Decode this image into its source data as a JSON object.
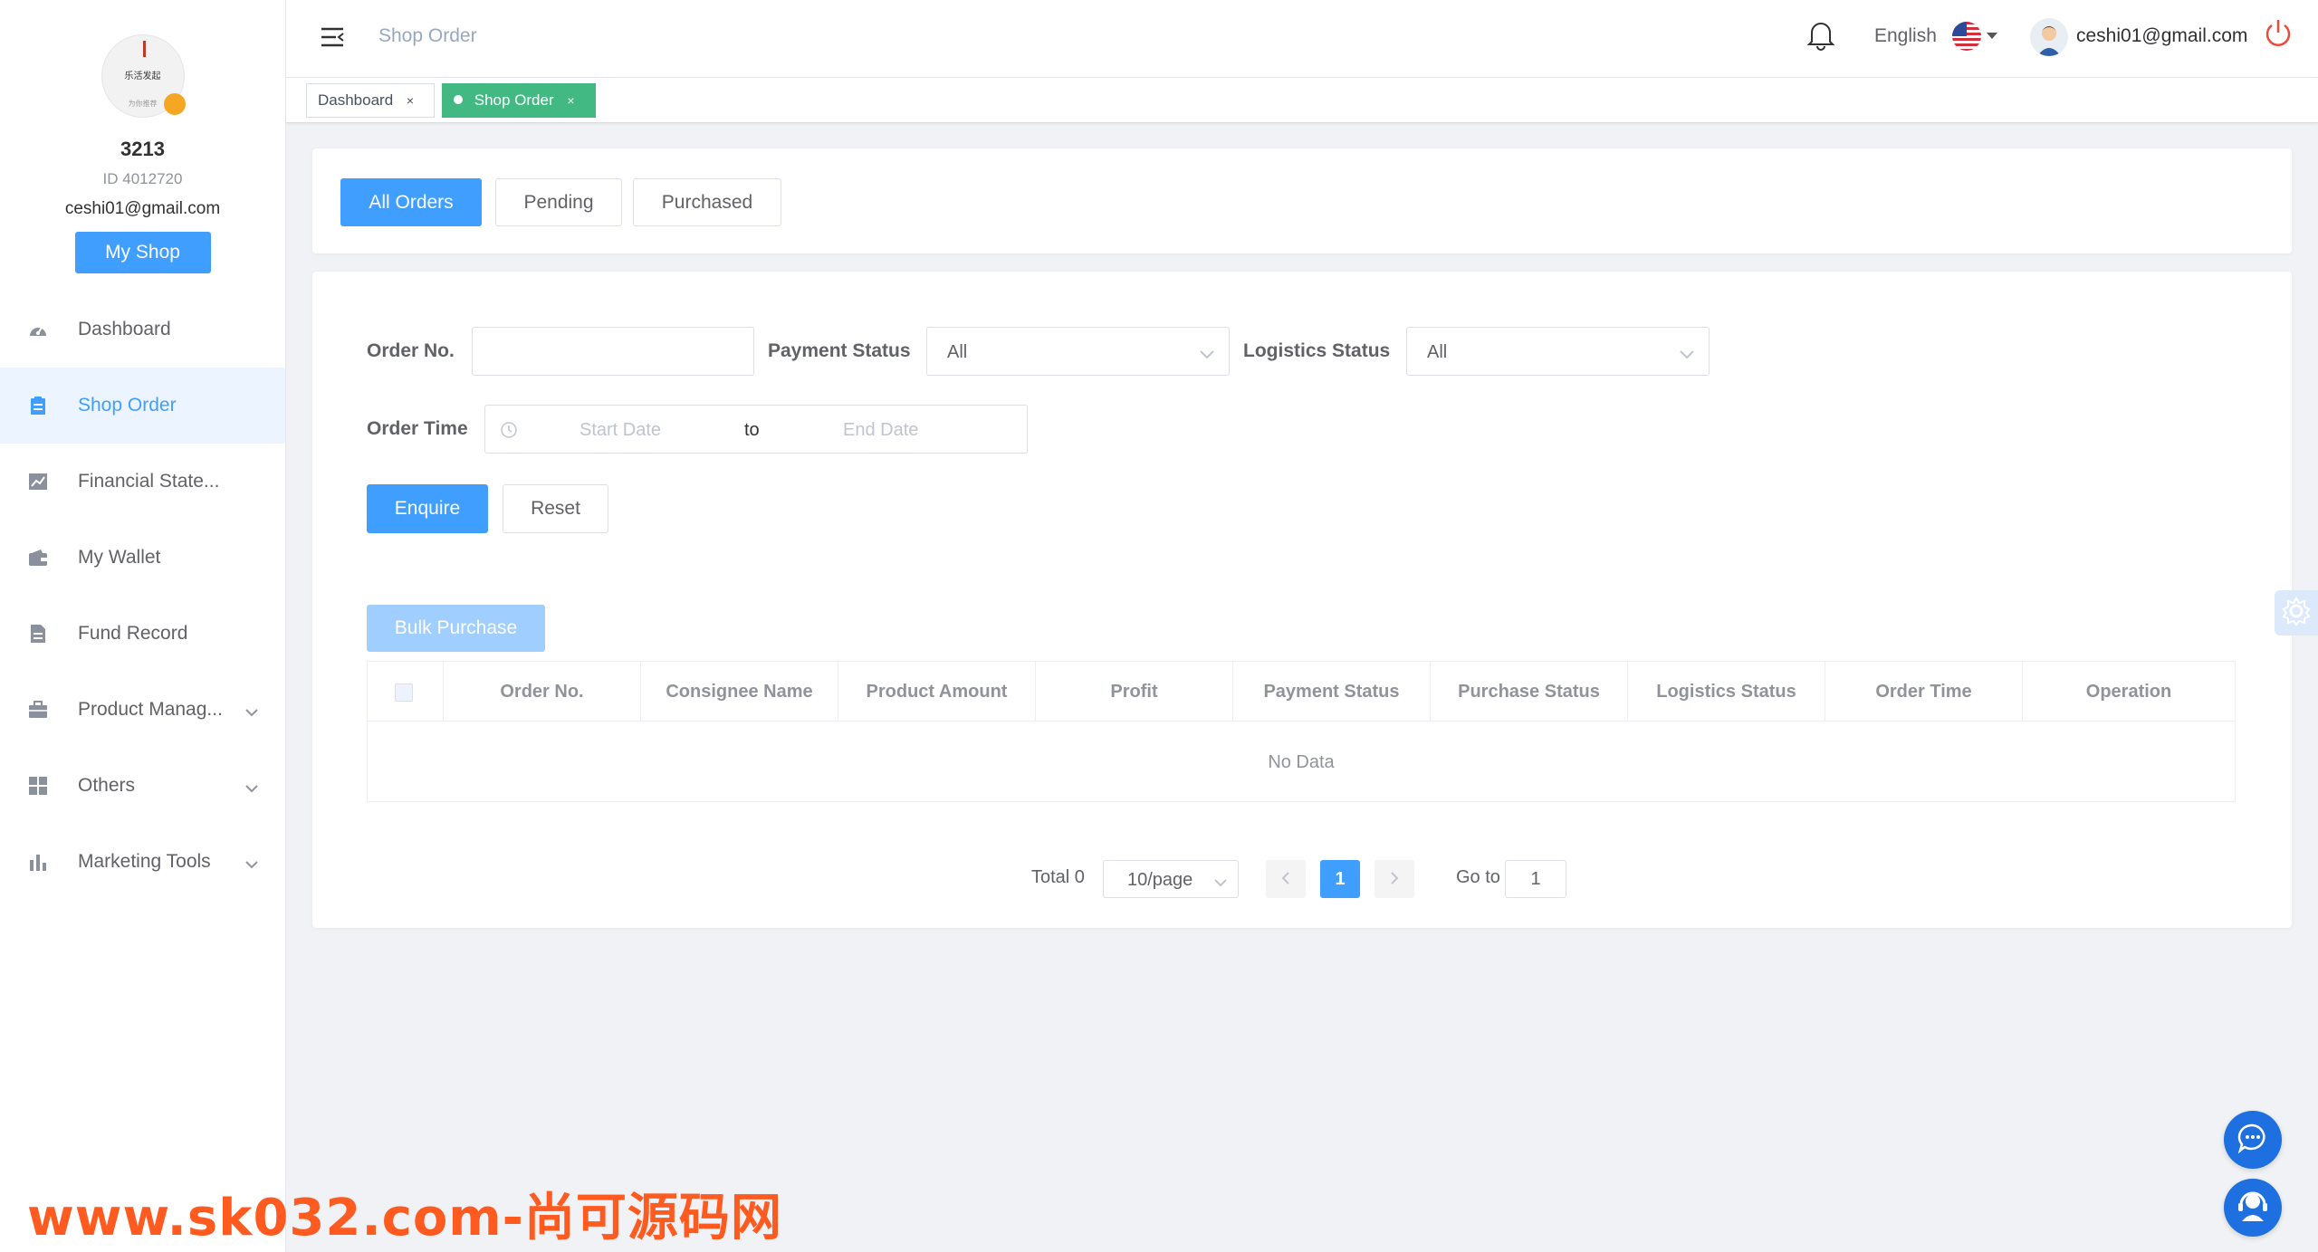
{
  "sidebar": {
    "avatar_text_top": "乐活发起",
    "avatar_text_bottom": "为你推荐",
    "username": "3213",
    "user_id": "ID 4012720",
    "email": "ceshi01@gmail.com",
    "my_shop_label": "My Shop",
    "items": [
      {
        "label": "Dashboard",
        "icon": "gauge-icon"
      },
      {
        "label": "Shop Order",
        "icon": "clipboard-icon"
      },
      {
        "label": "Financial State...",
        "icon": "chart-line-icon"
      },
      {
        "label": "My Wallet",
        "icon": "wallet-icon"
      },
      {
        "label": "Fund Record",
        "icon": "document-icon"
      },
      {
        "label": "Product Manag...",
        "icon": "briefcase-icon"
      },
      {
        "label": "Others",
        "icon": "grid-icon"
      },
      {
        "label": "Marketing Tools",
        "icon": "bar-chart-icon"
      }
    ]
  },
  "header": {
    "breadcrumb": "Shop Order",
    "language": "English",
    "user_email": "ceshi01@gmail.com"
  },
  "tags": {
    "dashboard": "Dashboard",
    "shop_order": "Shop Order",
    "close": "×"
  },
  "filter_tabs": {
    "all": "All Orders",
    "pending": "Pending",
    "purchased": "Purchased"
  },
  "form": {
    "order_no_label": "Order No.",
    "order_no_value": "",
    "payment_status_label": "Payment Status",
    "payment_status_value": "All",
    "logistics_status_label": "Logistics Status",
    "logistics_status_value": "All",
    "order_time_label": "Order Time",
    "start_placeholder": "Start Date",
    "range_separator": "to",
    "end_placeholder": "End Date",
    "enquire_label": "Enquire",
    "reset_label": "Reset",
    "bulk_purchase_label": "Bulk Purchase"
  },
  "table": {
    "columns": [
      "Order No.",
      "Consignee Name",
      "Product Amount",
      "Profit",
      "Payment Status",
      "Purchase Status",
      "Logistics Status",
      "Order Time",
      "Operation"
    ],
    "empty_text": "No Data"
  },
  "pagination": {
    "total": "Total 0",
    "page_size": "10/page",
    "current_page": "1",
    "goto_label": "Go to",
    "goto_value": "1"
  },
  "watermark": "www.sk032.com-尚可源码网",
  "colors": {
    "primary": "#409eff",
    "active_tag": "#42b983",
    "fab": "#1e6fe0",
    "watermark": "#ff5a1f"
  }
}
